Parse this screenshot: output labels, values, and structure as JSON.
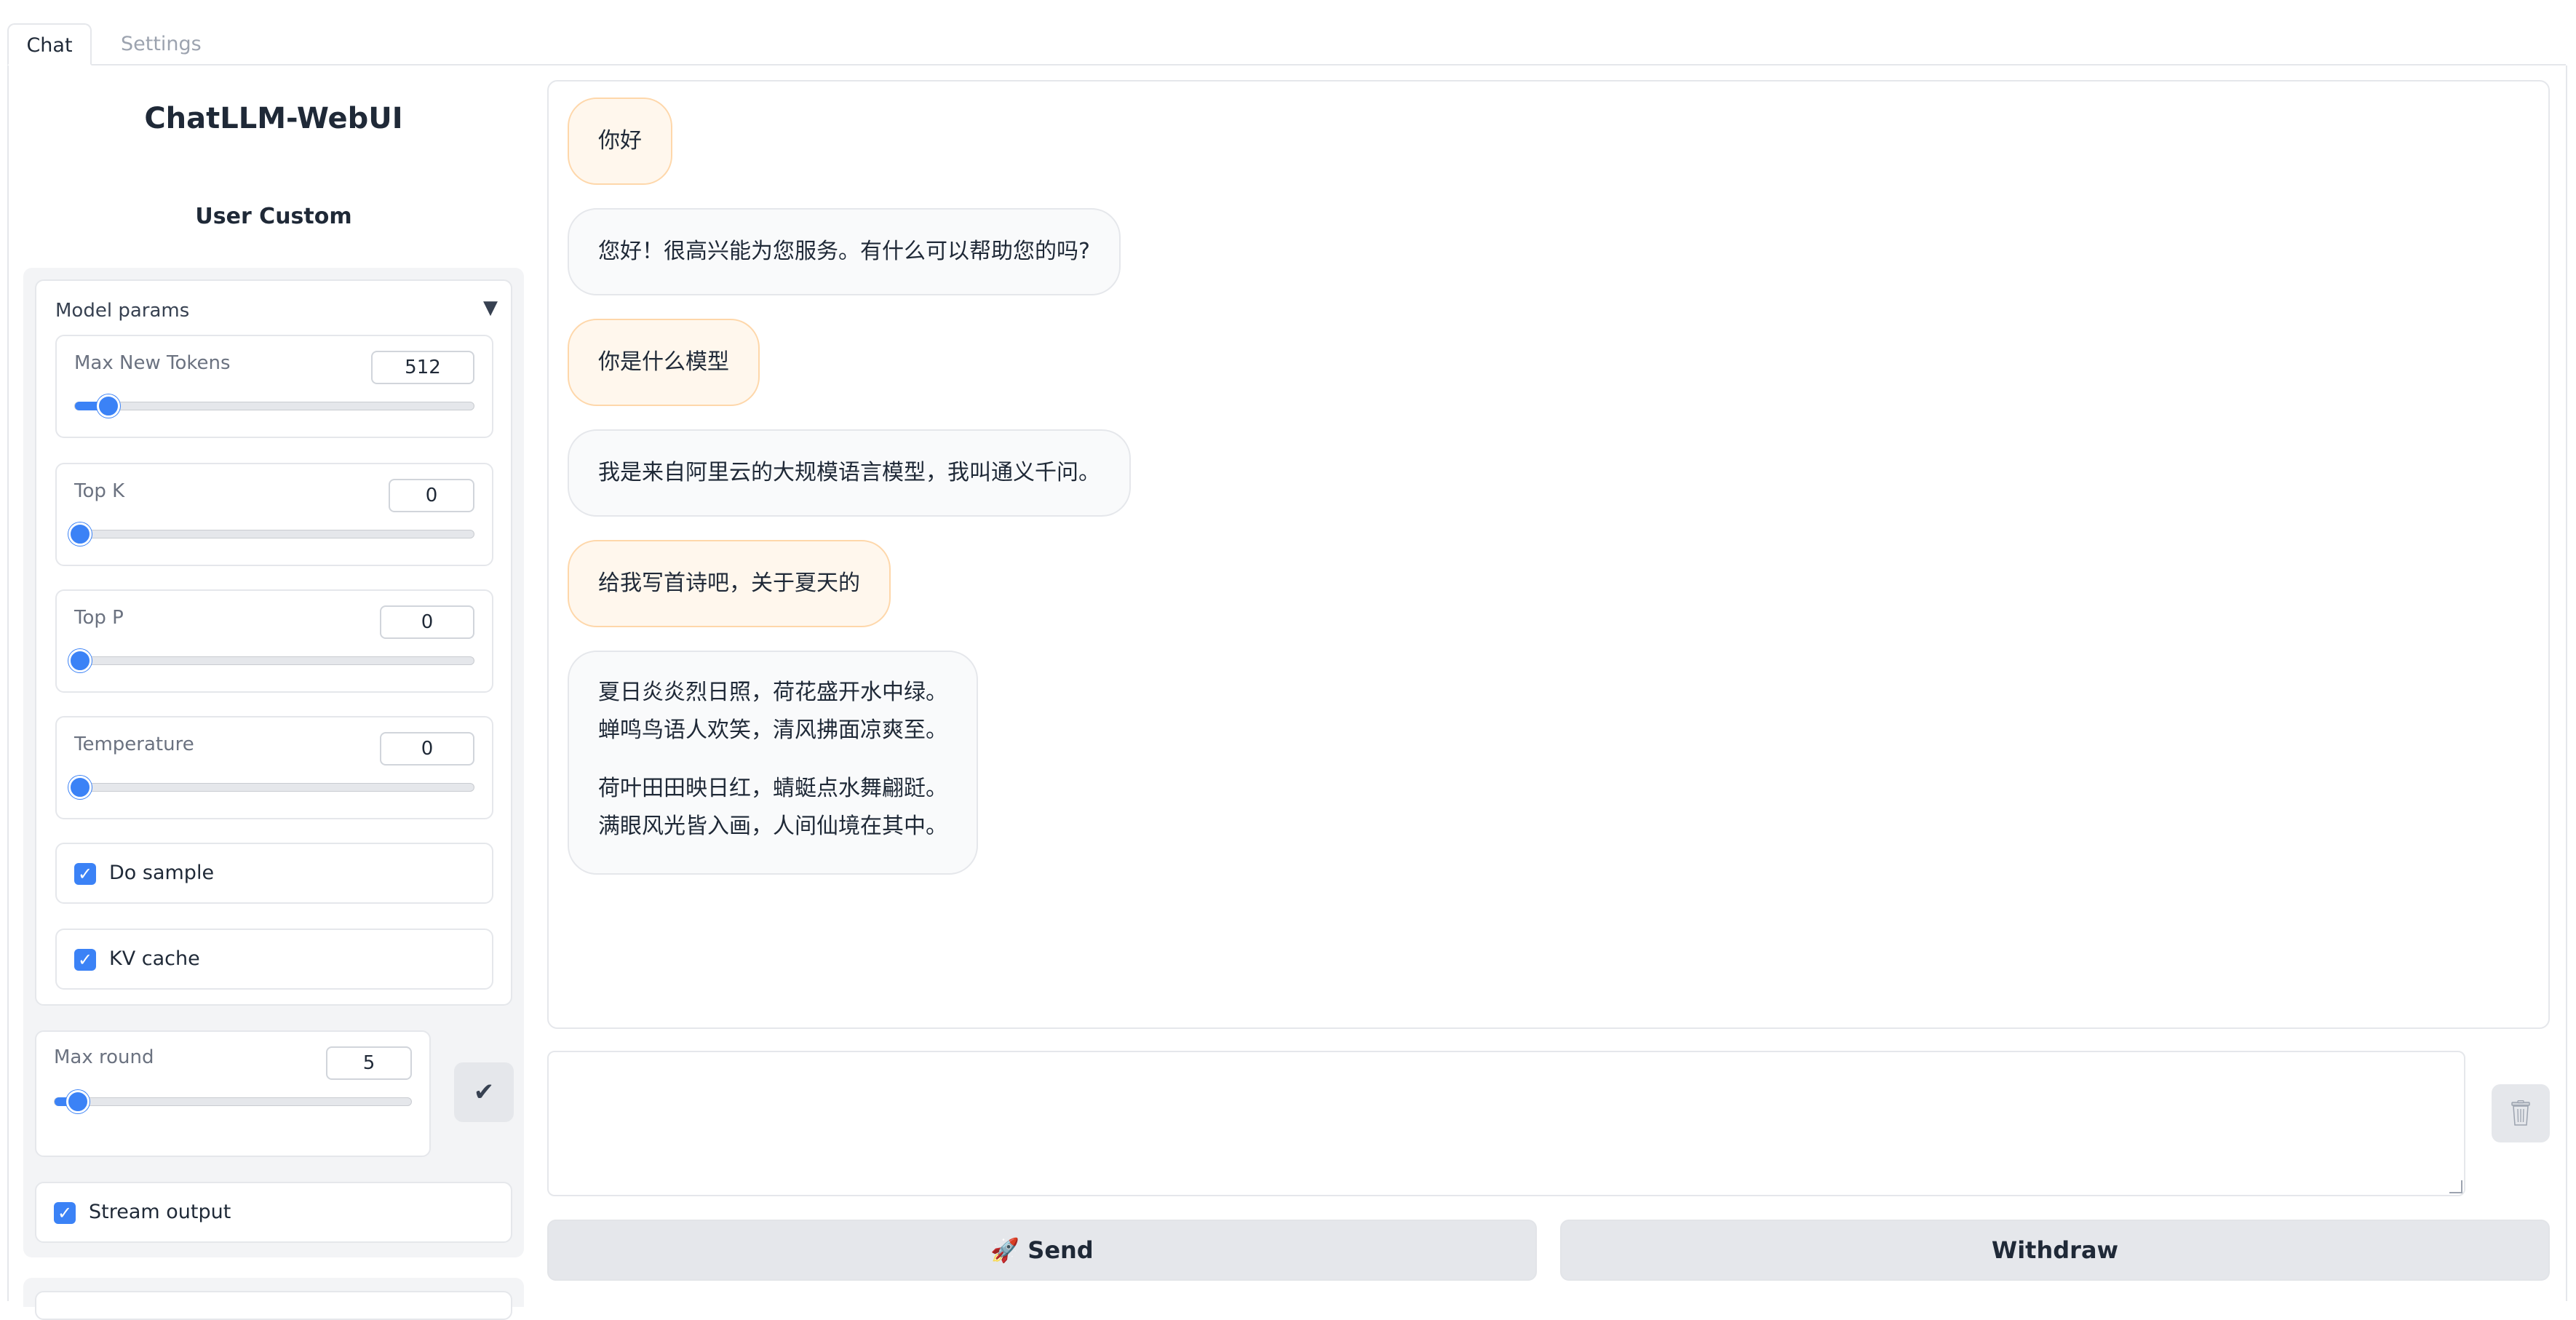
{
  "tabs": [
    {
      "label": "Chat"
    },
    {
      "label": "Settings"
    }
  ],
  "sidebar": {
    "app_title": "ChatLLM-WebUI",
    "section_title": "User Custom",
    "model_params": {
      "label": "Model params",
      "caret": "▼",
      "max_new_tokens": {
        "label": "Max New Tokens",
        "value": "512",
        "fraction": 0.07
      },
      "top_k": {
        "label": "Top K",
        "value": "0",
        "fraction": 0.0
      },
      "top_p": {
        "label": "Top P",
        "value": "0",
        "fraction": 0.0
      },
      "temperature": {
        "label": "Temperature",
        "value": "0",
        "fraction": 0.0
      },
      "do_sample": {
        "label": "Do sample",
        "checked": true
      },
      "kv_cache": {
        "label": "KV cache",
        "checked": true
      }
    },
    "max_round": {
      "label": "Max round",
      "value": "5",
      "fraction": 0.05
    },
    "confirm_icon": "✔",
    "stream_output": {
      "label": "Stream output",
      "checked": true
    }
  },
  "chat": {
    "messages": [
      {
        "role": "user",
        "lines": [
          "你好"
        ]
      },
      {
        "role": "bot",
        "lines": [
          "您好！很高兴能为您服务。有什么可以帮助您的吗?"
        ]
      },
      {
        "role": "user",
        "lines": [
          "你是什么模型"
        ]
      },
      {
        "role": "bot",
        "lines": [
          "我是来自阿里云的大规模语言模型，我叫通义千问。"
        ]
      },
      {
        "role": "user",
        "lines": [
          "给我写首诗吧，关于夏天的"
        ]
      },
      {
        "role": "bot",
        "lines": [
          "夏日炎炎烈日照，荷花盛开水中绿。",
          "蝉鸣鸟语人欢笑，清风拂面凉爽至。",
          "",
          "荷叶田田映日红，蜻蜓点水舞翩跹。",
          "满眼风光皆入画，人间仙境在其中。"
        ]
      }
    ]
  },
  "input": {
    "value": "",
    "placeholder": ""
  },
  "buttons": {
    "send": "🚀 Send",
    "withdraw": "Withdraw",
    "clear_icon": "trash-icon"
  },
  "colors": {
    "accent": "#3b82f6",
    "user_bubble": "#fff7ed",
    "bot_bubble": "#f9fafb"
  }
}
